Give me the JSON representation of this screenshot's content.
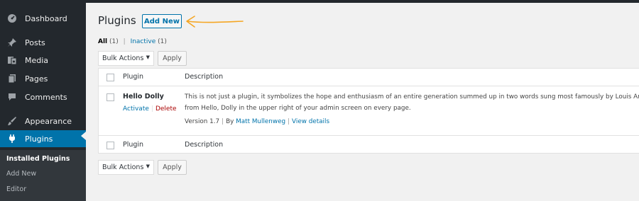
{
  "sidebar": {
    "items": [
      {
        "label": "Dashboard",
        "icon": "dashboard-icon"
      },
      {
        "label": "Posts",
        "icon": "pin-icon"
      },
      {
        "label": "Media",
        "icon": "media-icon"
      },
      {
        "label": "Pages",
        "icon": "pages-icon"
      },
      {
        "label": "Comments",
        "icon": "comment-icon"
      },
      {
        "label": "Appearance",
        "icon": "brush-icon"
      },
      {
        "label": "Plugins",
        "icon": "plugin-icon",
        "active": true
      }
    ],
    "submenu": [
      {
        "label": "Installed Plugins",
        "current": true
      },
      {
        "label": "Add New"
      },
      {
        "label": "Editor"
      }
    ]
  },
  "header": {
    "title": "Plugins",
    "add_new_label": "Add New"
  },
  "filters": {
    "all_label": "All",
    "all_count": "(1)",
    "separator": "|",
    "inactive_label": "Inactive",
    "inactive_count": "(1)"
  },
  "bulk_actions": {
    "select_value": "Bulk Actions",
    "apply_label": "Apply"
  },
  "table": {
    "columns": [
      "Plugin",
      "Description"
    ],
    "rows": [
      {
        "name": "Hello Dolly",
        "actions": [
          "Activate",
          "Delete"
        ],
        "action_separator": "|",
        "description_lines": [
          "This is not just a plugin, it symbolizes the hope and enthusiasm of an entire generation summed up in two words sung most famously by Louis Arms",
          "from Hello, Dolly in the upper right of your admin screen on every page."
        ],
        "version": "Version 1.7",
        "by_label": "By",
        "author": "Matt Mullenweg",
        "details_label": "View details"
      }
    ]
  },
  "colors": {
    "sidebar_bg": "#23282d",
    "active_bg": "#0073aa",
    "link": "#0073aa",
    "delete": "#a00",
    "annotation_arrow": "#f5a623"
  }
}
